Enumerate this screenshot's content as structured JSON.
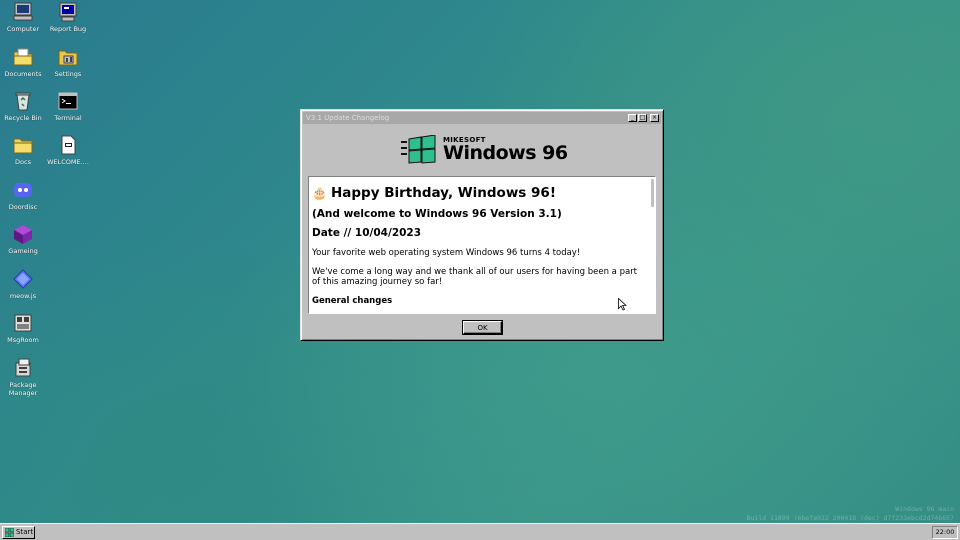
{
  "desktop": {
    "icons": [
      {
        "label": "Computer",
        "icon": "computer-icon"
      },
      {
        "label": "Report Bug",
        "icon": "report-bug-icon"
      },
      {
        "label": "Documents",
        "icon": "documents-folder-icon"
      },
      {
        "label": "Settings",
        "icon": "settings-icon"
      },
      {
        "label": "Recycle Bin",
        "icon": "recycle-bin-icon"
      },
      {
        "label": "Terminal",
        "icon": "terminal-icon"
      },
      {
        "label": "Docs",
        "icon": "folder-icon"
      },
      {
        "label": "WELCOME....",
        "icon": "text-file-icon"
      },
      {
        "label": "Doordisc",
        "icon": "doordisc-icon"
      },
      {
        "label": "Gameing",
        "icon": "gameing-icon"
      },
      {
        "label": "meow.js",
        "icon": "meowjs-icon"
      },
      {
        "label": "MsgRoom",
        "icon": "msgroom-icon"
      },
      {
        "label": "Package Manager",
        "icon": "package-manager-icon"
      }
    ]
  },
  "window": {
    "title": "V3.1 Update Changelog",
    "minimize": "_",
    "maximize": "□",
    "close": "×",
    "logo": {
      "brand": "MIKESOFT",
      "product": "Windows 96"
    },
    "content": {
      "emoji": "🎂",
      "heading": "Happy Birthday, Windows 96!",
      "subheading": "(And welcome to Windows 96 Version 3.1)",
      "date": "Date // 10/04/2023",
      "para1": "Your favorite web operating system Windows 96 turns 4 today!",
      "para2": "We've come a long way and we thank all of our users for having been a part of this amazing journey so far!",
      "section": "General changes"
    },
    "ok_label": "OK"
  },
  "watermark": {
    "line1": "Windows 96 main",
    "line2": "Build 11899 (6befa922 200418 (dec) d7f233ebcd2d74b657"
  },
  "taskbar": {
    "start_label": "Start",
    "clock": "22:00"
  }
}
